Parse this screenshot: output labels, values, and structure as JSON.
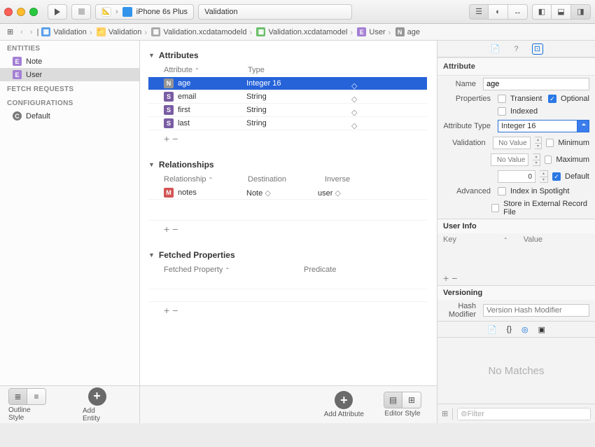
{
  "toolbar": {
    "scheme_app": "A",
    "scheme_device": "iPhone 6s Plus",
    "status": "Validation"
  },
  "jumpbar": {
    "items": [
      "Validation",
      "Validation",
      "Validation.xcdatamodeld",
      "Validation.xcdatamodel",
      "User",
      "age"
    ]
  },
  "nav": {
    "entities_header": "ENTITIES",
    "entities": [
      "Note",
      "User"
    ],
    "fetch_header": "FETCH REQUESTS",
    "config_header": "CONFIGURATIONS",
    "config_item": "Default",
    "outline_label": "Outline Style",
    "add_entity_label": "Add Entity"
  },
  "editor": {
    "attributes": {
      "header": "Attributes",
      "col_attr": "Attribute",
      "col_type": "Type",
      "rows": [
        {
          "icon": "N",
          "name": "age",
          "type": "Integer 16",
          "sel": true
        },
        {
          "icon": "S",
          "name": "email",
          "type": "String"
        },
        {
          "icon": "S",
          "name": "first",
          "type": "String"
        },
        {
          "icon": "S",
          "name": "last",
          "type": "String"
        }
      ]
    },
    "relationships": {
      "header": "Relationships",
      "col_rel": "Relationship",
      "col_dest": "Destination",
      "col_inv": "Inverse",
      "rows": [
        {
          "icon": "M",
          "name": "notes",
          "dest": "Note",
          "inv": "user"
        }
      ]
    },
    "fetched": {
      "header": "Fetched Properties",
      "col_fp": "Fetched Property",
      "col_pred": "Predicate"
    },
    "add_attr_label": "Add Attribute",
    "editor_style_label": "Editor Style"
  },
  "inspector": {
    "attribute_header": "Attribute",
    "name_label": "Name",
    "name_value": "age",
    "props_label": "Properties",
    "transient": "Transient",
    "optional": "Optional",
    "indexed": "Indexed",
    "attr_type_label": "Attribute Type",
    "attr_type_value": "Integer 16",
    "validation_label": "Validation",
    "novalue": "No Value",
    "minimum": "Minimum",
    "maximum": "Maximum",
    "default_val": "0",
    "default": "Default",
    "advanced_label": "Advanced",
    "spotlight": "Index in Spotlight",
    "external": "Store in External Record File",
    "userinfo_header": "User Info",
    "key": "Key",
    "value": "Value",
    "versioning_header": "Versioning",
    "hash_label": "Hash Modifier",
    "hash_placeholder": "Version Hash Modifier",
    "nomatch": "No Matches",
    "filter_placeholder": "Filter"
  }
}
